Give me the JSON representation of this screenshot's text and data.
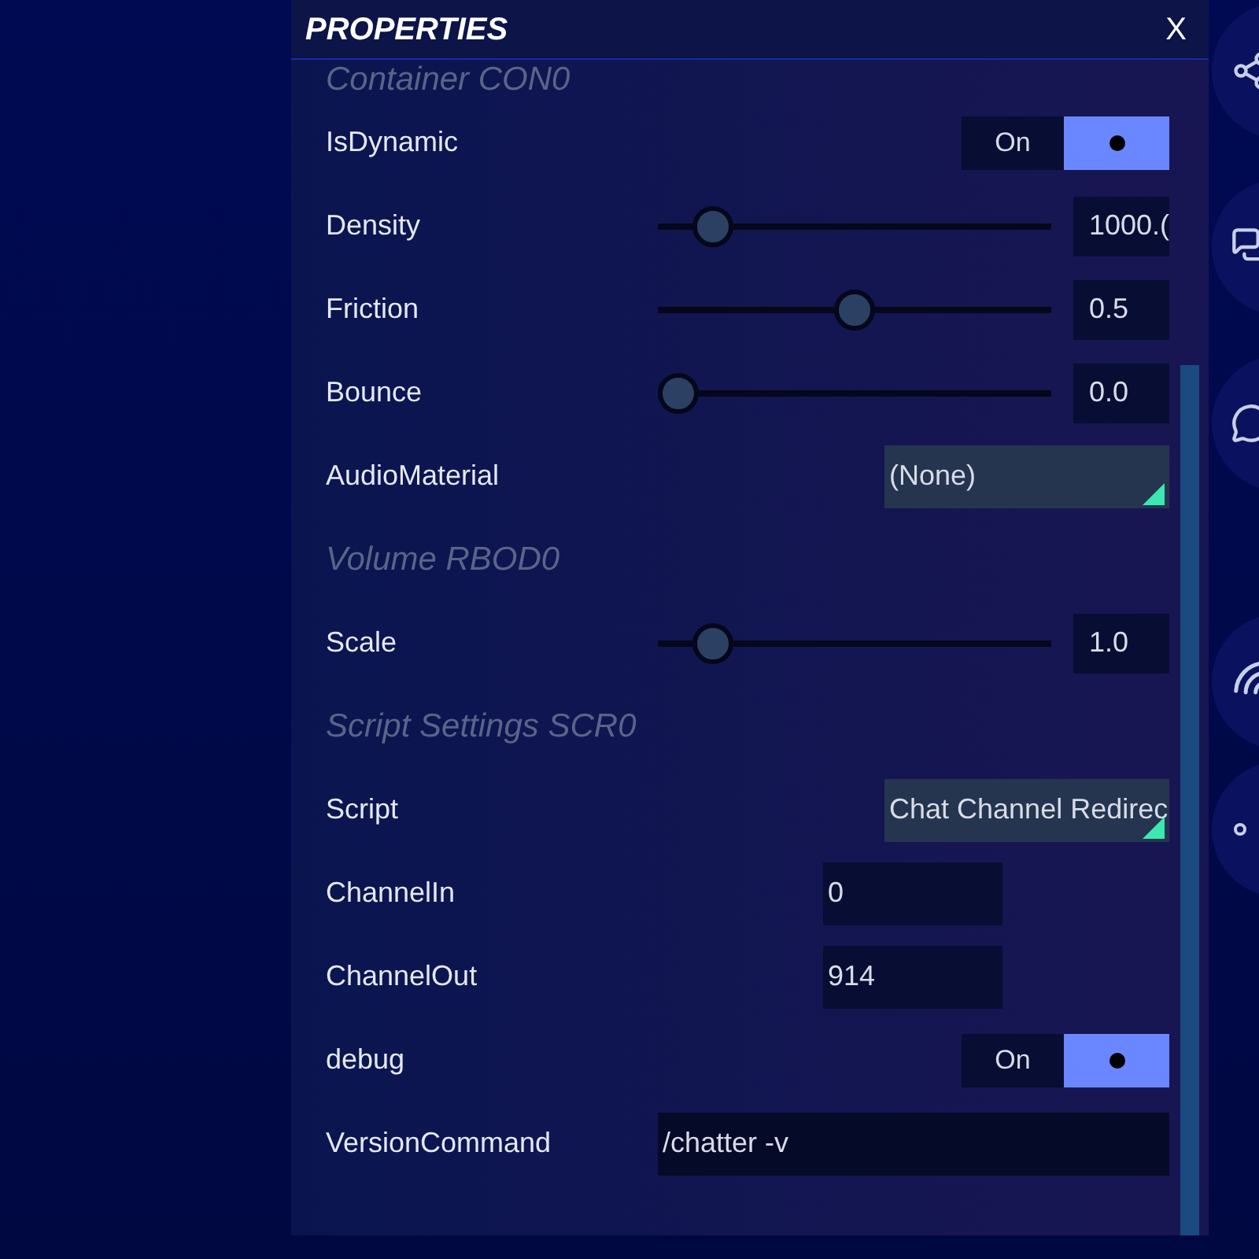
{
  "panel": {
    "title": "PROPERTIES",
    "close": "X"
  },
  "rows": [
    {
      "kind": "section",
      "label": "Container CON0"
    },
    {
      "kind": "toggle",
      "label": "IsDynamic",
      "text": "On",
      "on": true
    },
    {
      "kind": "slider",
      "label": "Density",
      "level": 0.1,
      "value": "1000.("
    },
    {
      "kind": "slider",
      "label": "Friction",
      "level": 0.5,
      "value": "0.5"
    },
    {
      "kind": "slider",
      "label": "Bounce",
      "level": 0,
      "value": "0.0"
    },
    {
      "kind": "dropdown",
      "label": "AudioMaterial",
      "value": "(None)"
    },
    {
      "kind": "section",
      "label": "Volume RBOD0"
    },
    {
      "kind": "slider",
      "label": "Scale",
      "level": 0.1,
      "value": "1.0"
    },
    {
      "kind": "section",
      "label": "Script Settings SCR0"
    },
    {
      "kind": "dropdown",
      "label": "Script",
      "value": "Chat Channel Redirec"
    },
    {
      "kind": "text",
      "label": "ChannelIn",
      "value": "0"
    },
    {
      "kind": "text",
      "label": "ChannelOut",
      "value": "914"
    },
    {
      "kind": "toggle",
      "label": "debug",
      "text": "On",
      "on": true
    },
    {
      "kind": "wide",
      "label": "VersionCommand",
      "value": "/chatter -v"
    }
  ]
}
